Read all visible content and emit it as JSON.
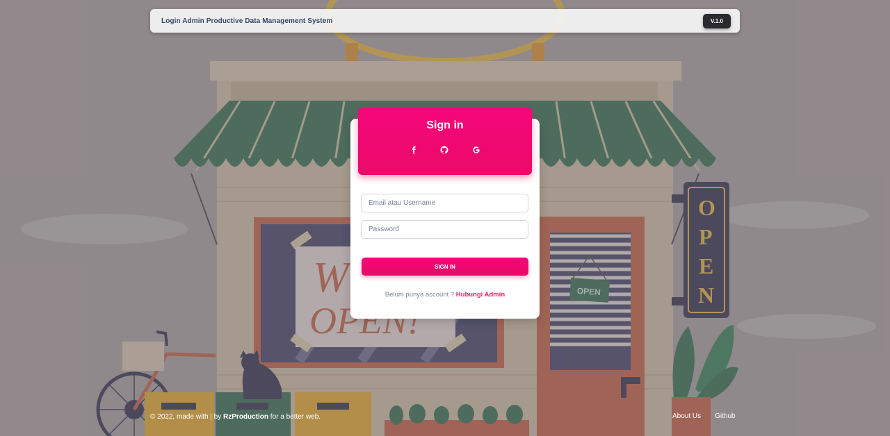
{
  "navbar": {
    "brand": "Login Admin Productive Data Management System",
    "version": "V.1.0"
  },
  "card": {
    "title": "Sign in",
    "social_icons": [
      "facebook-icon",
      "github-icon",
      "google-icon"
    ],
    "email_placeholder": "Email atau Username",
    "password_placeholder": "Password",
    "signin_label": "SIGN IN",
    "signup_prompt": "Belum punya account ? ",
    "signup_link": "Hubungi Admin"
  },
  "background": {
    "sign_text": "OPEN",
    "window_sign_text": "We're OPEN!",
    "door_sign_text": "OPEN"
  },
  "footer": {
    "copyright_prefix": "© 2022, made with | by ",
    "copyright_author": "RzProduction",
    "copyright_suffix": " for a better web.",
    "links": [
      "About Us",
      "Github"
    ]
  },
  "colors": {
    "accent": "#e91e63",
    "navbar_text": "#344767",
    "version_bg": "#2b2b2f"
  }
}
